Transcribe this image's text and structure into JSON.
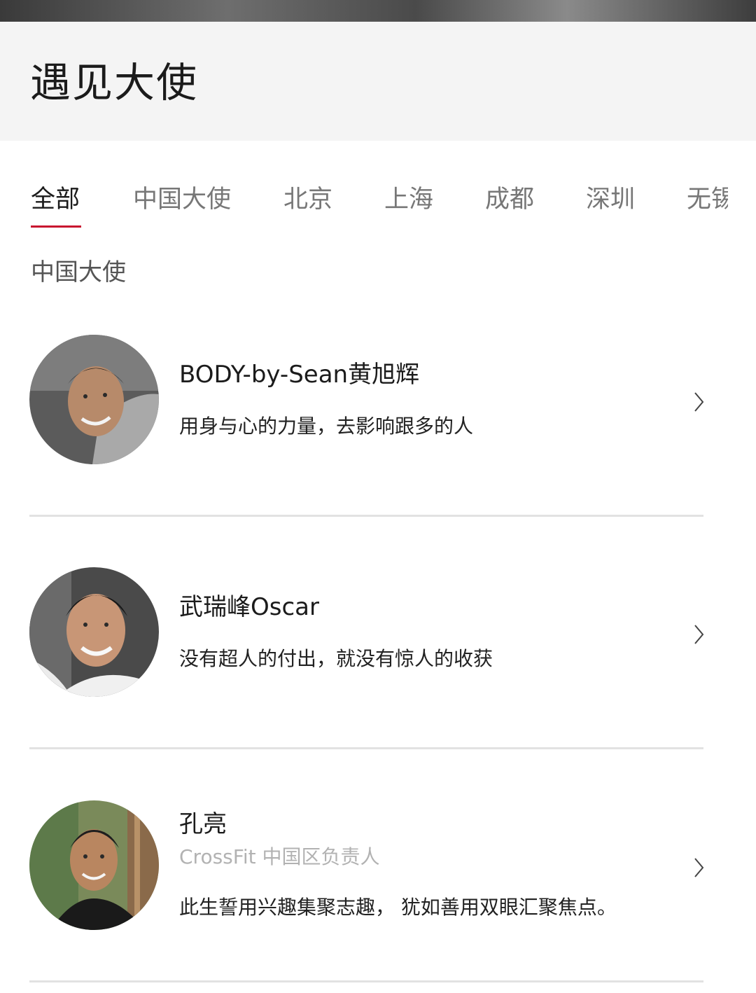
{
  "page": {
    "title": "遇见大使"
  },
  "tabs": [
    {
      "label": "全部",
      "active": true
    },
    {
      "label": "中国大使",
      "active": false
    },
    {
      "label": "北京",
      "active": false
    },
    {
      "label": "上海",
      "active": false
    },
    {
      "label": "成都",
      "active": false
    },
    {
      "label": "深圳",
      "active": false
    },
    {
      "label": "无锡",
      "active": false
    }
  ],
  "section": {
    "title": "中国大使"
  },
  "ambassadors": [
    {
      "name": "BODY-by-Sean黄旭辉",
      "role": "",
      "motto": "用身与心的力量，去影响跟多的人"
    },
    {
      "name": "武瑞峰Oscar",
      "role": "",
      "motto": "没有超人的付出，就没有惊人的收获"
    },
    {
      "name": "孔亮",
      "role": "CrossFit 中国区负责人",
      "motto": "此生誓用兴趣集聚志趣， 犹如善用双眼汇聚焦点。"
    }
  ],
  "colors": {
    "accent": "#c8102e",
    "header_bg": "#f4f4f4",
    "divider": "#e2e2e2"
  },
  "icons": {
    "chevron": "chevron-right-icon"
  }
}
